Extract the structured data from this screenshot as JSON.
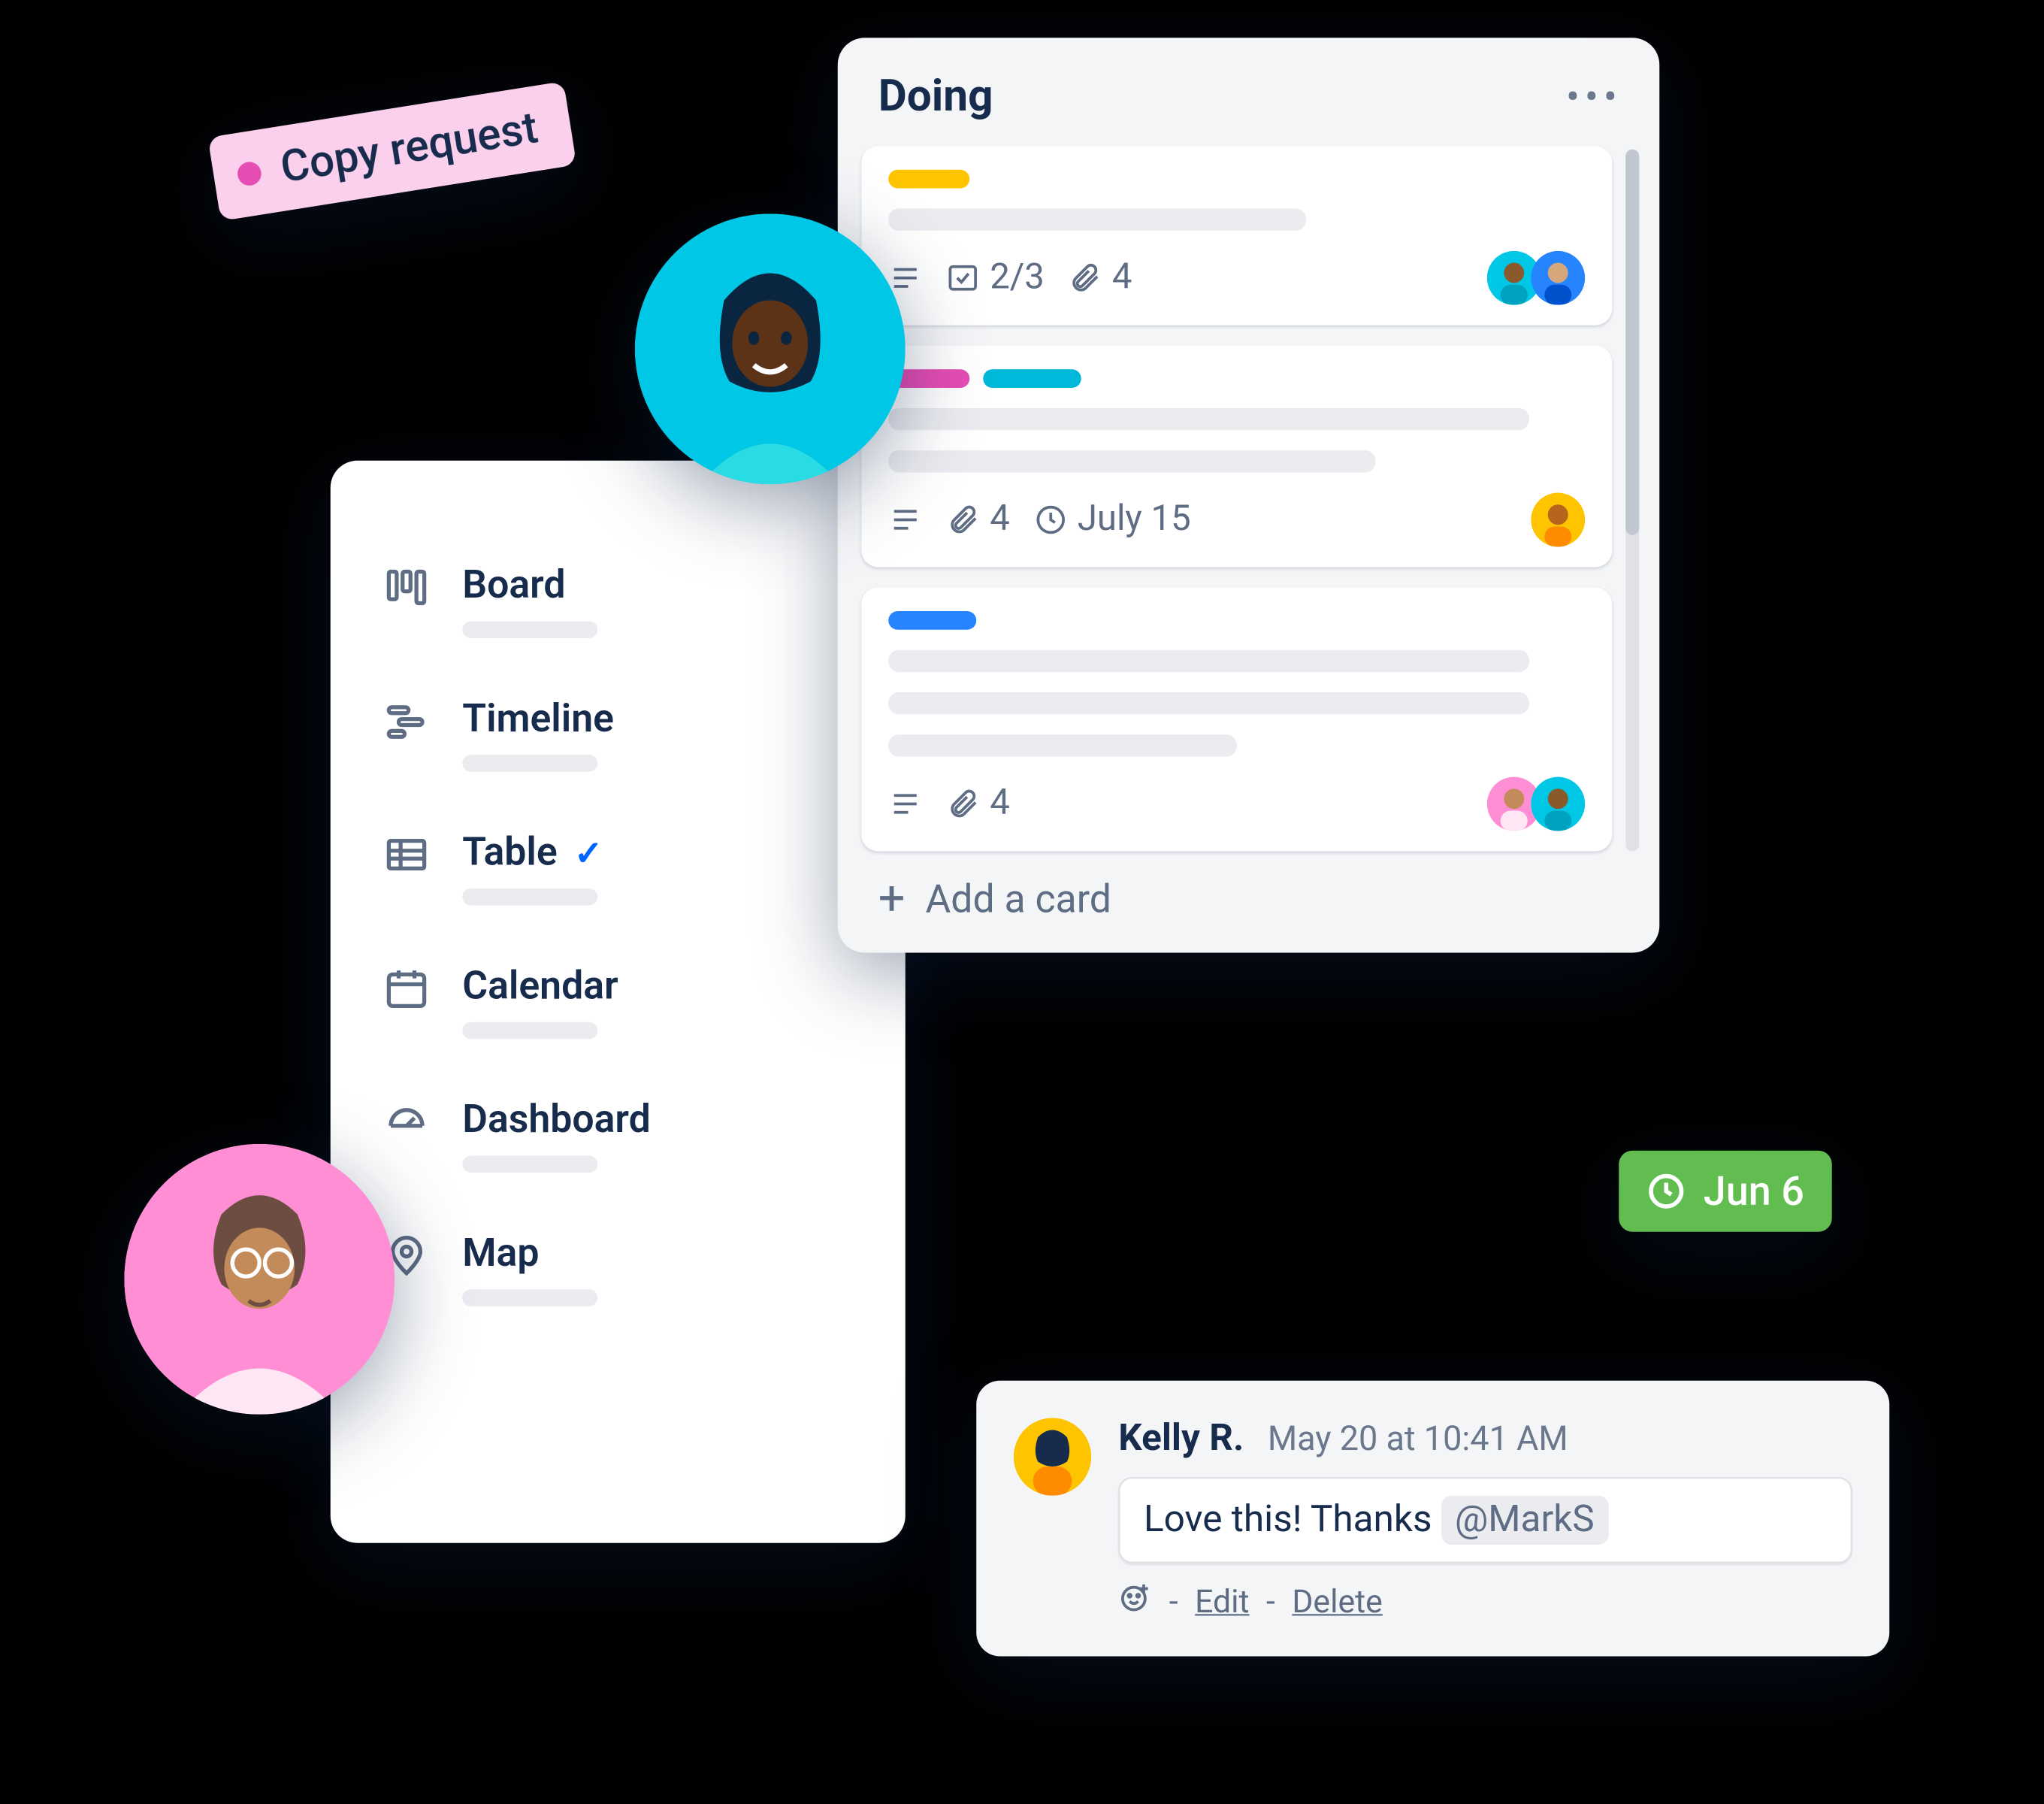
{
  "tag": {
    "label": "Copy request"
  },
  "views": {
    "items": [
      {
        "label": "Board"
      },
      {
        "label": "Timeline"
      },
      {
        "label": "Table",
        "selected": true
      },
      {
        "label": "Calendar"
      },
      {
        "label": "Dashboard"
      },
      {
        "label": "Map"
      }
    ]
  },
  "column": {
    "title": "Doing",
    "add_label": "Add a card",
    "cards": [
      {
        "labels": [
          "yellow"
        ],
        "checklist": "2/3",
        "attachments": "4",
        "members": [
          "teal",
          "blue"
        ]
      },
      {
        "labels": [
          "pink",
          "cyan"
        ],
        "attachments": "4",
        "due": "July 15",
        "members": [
          "yellow"
        ]
      },
      {
        "labels": [
          "blue"
        ],
        "attachments": "4",
        "members": [
          "pink",
          "teal"
        ]
      }
    ]
  },
  "date_badge": {
    "label": "Jun 6"
  },
  "comment": {
    "author": "Kelly R.",
    "timestamp": "May 20 at 10:41 AM",
    "text": "Love this! Thanks",
    "mention": "@MarkS",
    "actions": {
      "edit": "Edit",
      "delete": "Delete",
      "sep": "-"
    }
  }
}
